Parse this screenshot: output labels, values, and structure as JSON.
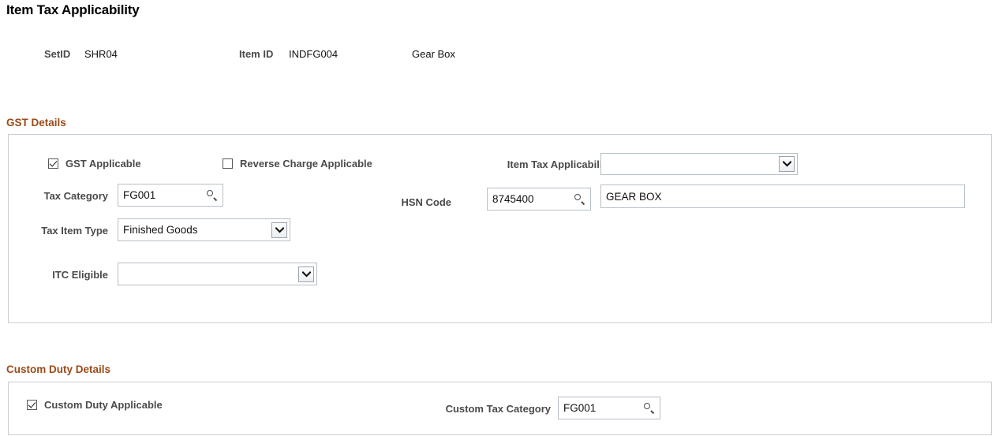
{
  "page": {
    "title": "Item Tax Applicability"
  },
  "header": {
    "setid_label": "SetID",
    "setid_value": "SHR04",
    "item_id_label": "Item ID",
    "item_id_value": "INDFG004",
    "item_description": "Gear Box"
  },
  "gst_section": {
    "title": "GST Details",
    "gst_applicable": {
      "label": "GST Applicable",
      "checked": true
    },
    "reverse_charge_applicable": {
      "label": "Reverse Charge Applicable",
      "checked": false
    },
    "item_tax_applicability": {
      "label": "Item Tax Applicability",
      "value": ""
    },
    "tax_category": {
      "label": "Tax Category",
      "value": "FG001",
      "icon": "magnifier-icon"
    },
    "hsn_code": {
      "label": "HSN Code",
      "value": "8745400",
      "icon": "magnifier-icon",
      "description": "GEAR BOX"
    },
    "tax_item_type": {
      "label": "Tax Item Type",
      "value": "Finished Goods"
    },
    "itc_eligible": {
      "label": "ITC Eligible",
      "value": ""
    }
  },
  "custom_duty_section": {
    "title": "Custom Duty Details",
    "custom_duty_applicable": {
      "label": "Custom Duty Applicable",
      "checked": true
    },
    "custom_tax_category": {
      "label": "Custom Tax Category",
      "value": "FG001",
      "icon": "magnifier-icon"
    }
  },
  "colors": {
    "section_header": "#9c4a17",
    "label": "#4a4a4a",
    "panel_border": "#c9cfd6",
    "field_border": "#b6bfc9"
  }
}
